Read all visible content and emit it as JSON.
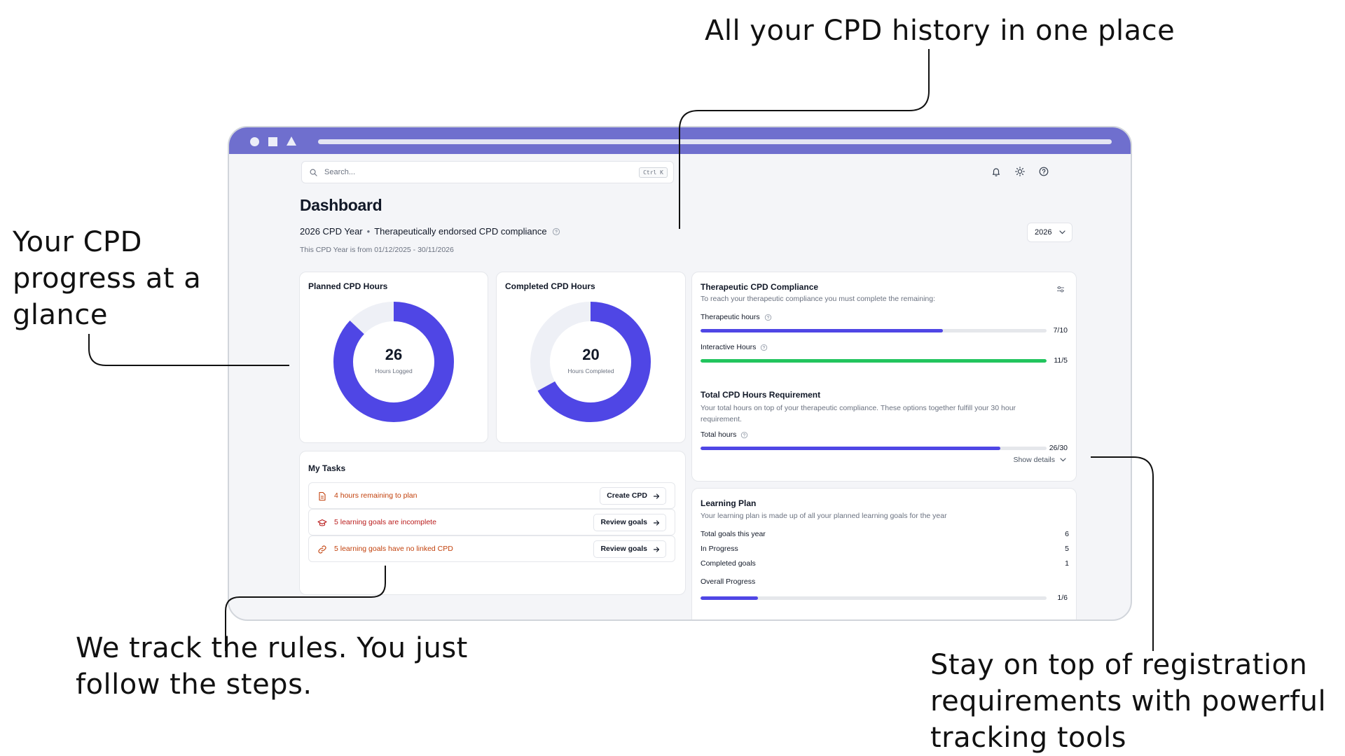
{
  "callouts": {
    "top": "All your CPD history in one place",
    "left": "Your CPD progress at a glance",
    "bottom_left": "We track the rules. You just follow the steps.",
    "bottom_right": "Stay on top of registration requirements with powerful tracking tools"
  },
  "header": {
    "search_placeholder": "Search...",
    "search_shortcut": "Ctrl K",
    "icons": [
      "bell-icon",
      "sun-icon",
      "help-icon"
    ]
  },
  "dashboard": {
    "title": "Dashboard",
    "cpd_year": "2026 CPD Year",
    "compliance_type": "Therapeutically endorsed CPD compliance",
    "year_range": "This CPD Year is from 01/12/2025 - 30/11/2026",
    "year_select": "2026"
  },
  "planned": {
    "title": "Planned CPD Hours",
    "value": "26",
    "label": "Hours Logged",
    "fraction": 0.87
  },
  "completed": {
    "title": "Completed CPD Hours",
    "value": "20",
    "label": "Hours Completed",
    "fraction": 0.67
  },
  "tasks": {
    "title": "My Tasks",
    "items": [
      {
        "text": "4 hours remaining to plan",
        "button": "Create CPD",
        "color": "#c2410c",
        "icon": "document-icon"
      },
      {
        "text": "5 learning goals are incomplete",
        "button": "Review goals",
        "color": "#b91c1c",
        "icon": "graduation-cap-icon"
      },
      {
        "text": "5 learning goals have no linked CPD",
        "button": "Review goals",
        "color": "#c2410c",
        "icon": "link-icon"
      }
    ]
  },
  "compliance": {
    "title": "Therapeutic CPD Compliance",
    "subtitle": "To reach your therapeutic compliance you must complete the remaining:",
    "therapeutic": {
      "label": "Therapeutic hours",
      "value": "7/10",
      "fraction": 0.7,
      "color": "#4f46e5"
    },
    "interactive": {
      "label": "Interactive Hours",
      "value": "11/5",
      "fraction": 1.0,
      "color": "#22c55e"
    },
    "total_title": "Total CPD Hours Requirement",
    "total_desc": "Your total hours on top of your therapeutic compliance. These options together fulfill your 30 hour requirement.",
    "total": {
      "label": "Total hours",
      "value": "26/30",
      "fraction": 0.8667,
      "color": "#4f46e5"
    },
    "show_details": "Show details"
  },
  "learning": {
    "title": "Learning Plan",
    "subtitle": "Your learning plan is made up of all your planned learning goals for the year",
    "rows": [
      {
        "label": "Total goals this year",
        "value": "6"
      },
      {
        "label": "In Progress",
        "value": "5"
      },
      {
        "label": "Completed goals",
        "value": "1"
      }
    ],
    "overall_label": "Overall Progress",
    "overall_value": "1/6",
    "overall_fraction": 0.1667
  },
  "colors": {
    "accent": "#4f46e5",
    "titlebar": "#6f6fce",
    "donut_track": "#eef0f6",
    "success": "#22c55e"
  }
}
